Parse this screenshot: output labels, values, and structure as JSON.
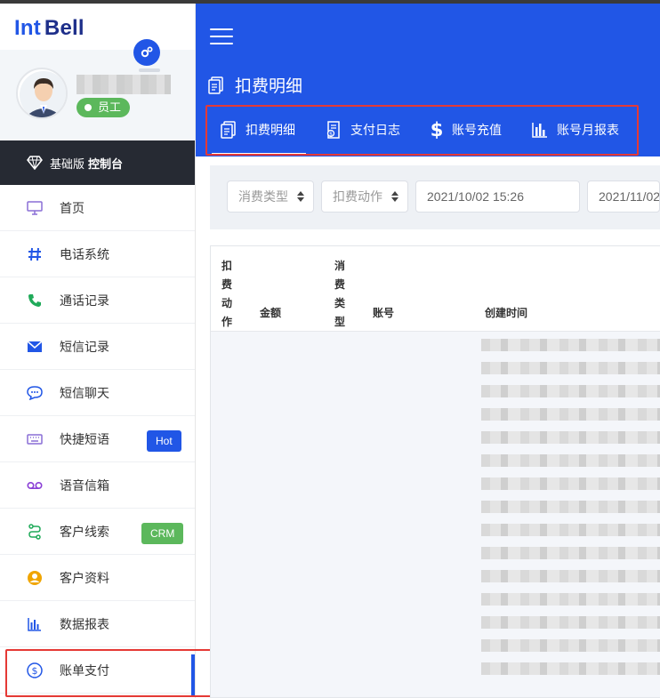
{
  "sidebar": {
    "logo": {
      "part1": "Int",
      "part2": "Bell"
    },
    "profile": {
      "role_badge": "员工"
    },
    "edition": {
      "prefix": "基础版",
      "bold": "控制台"
    },
    "nav_items": [
      {
        "label": "首页",
        "icon": "monitor-icon",
        "color": "#8a6fd6"
      },
      {
        "label": "电话系统",
        "icon": "hash-icon",
        "color": "#2156e6"
      },
      {
        "label": "通话记录",
        "icon": "phone-icon",
        "color": "#1faa59"
      },
      {
        "label": "短信记录",
        "icon": "envelope-icon",
        "color": "#2156e6"
      },
      {
        "label": "短信聊天",
        "icon": "chat-bubble-icon",
        "color": "#2156e6"
      },
      {
        "label": "快捷短语",
        "icon": "keyboard-icon",
        "color": "#8a6fd6",
        "tag": "Hot"
      },
      {
        "label": "语音信箱",
        "icon": "voicemail-icon",
        "color": "#8a3fd6"
      },
      {
        "label": "客户线索",
        "icon": "route-icon",
        "color": "#1faa59",
        "tag": "CRM"
      },
      {
        "label": "客户资料",
        "icon": "user-circle-icon",
        "color": "#f0a500"
      },
      {
        "label": "数据报表",
        "icon": "bar-chart-icon",
        "color": "#2156e6"
      },
      {
        "label": "账单支付",
        "icon": "dollar-circle-icon",
        "color": "#2156e6",
        "active": true
      }
    ]
  },
  "header": {
    "page_title": "扣费明细",
    "tabs": [
      {
        "label": "扣费明细",
        "icon": "document-icon",
        "active": true
      },
      {
        "label": "支付日志",
        "icon": "receipt-icon"
      },
      {
        "label": "账号充值",
        "icon": "dollar-icon"
      },
      {
        "label": "账号月报表",
        "icon": "bar-chart-icon"
      }
    ]
  },
  "filters": {
    "consume_type_placeholder": "消费类型",
    "deduct_action_placeholder": "扣费动作",
    "start_date": "2021/10/02 15:26",
    "end_date": "2021/11/02"
  },
  "table": {
    "columns": [
      "扣费动作",
      "金额",
      "消费类型",
      "账号",
      "创建时间"
    ]
  },
  "colors": {
    "brand_blue": "#2156e6",
    "success_green": "#5cb85c",
    "dark_bar": "#262a33",
    "highlight_red": "#e53935"
  }
}
